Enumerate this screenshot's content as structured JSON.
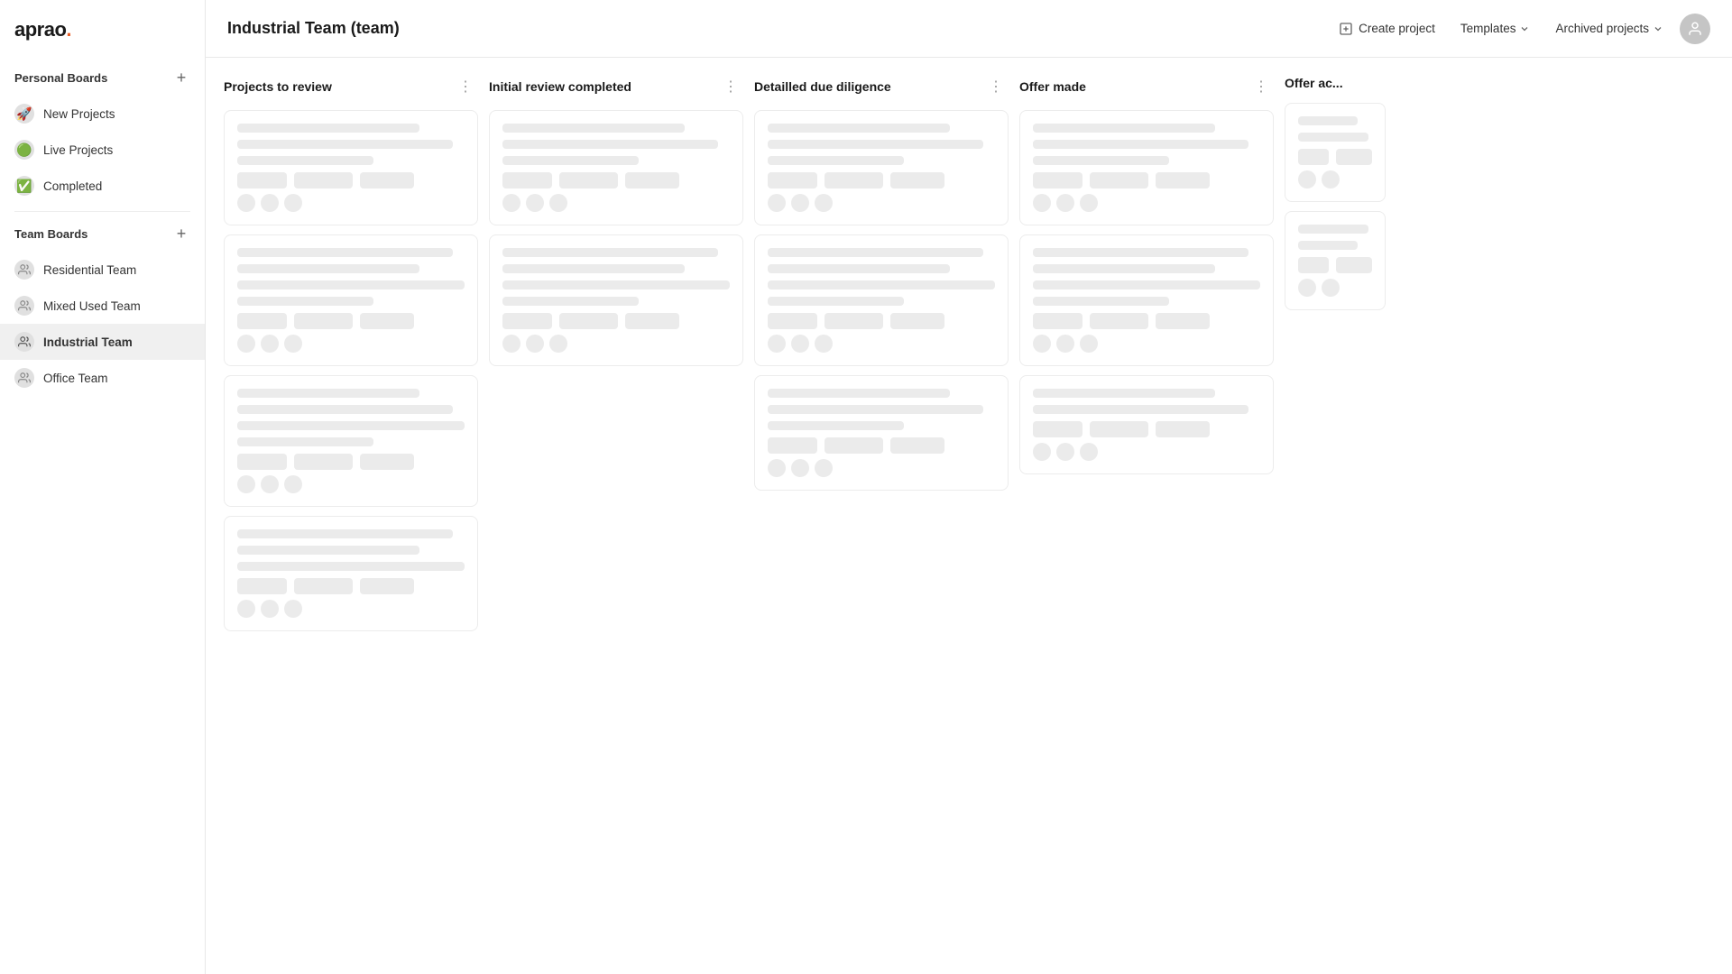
{
  "app": {
    "logo": "aprao",
    "logo_accent": "."
  },
  "sidebar": {
    "personal_boards_label": "Personal Boards",
    "team_boards_label": "Team Boards",
    "personal_items": [
      {
        "id": "new-projects",
        "label": "New Projects",
        "emoji": "🚀"
      },
      {
        "id": "live-projects",
        "label": "Live Projects",
        "emoji": "🟢"
      },
      {
        "id": "completed",
        "label": "Completed",
        "emoji": "✅"
      }
    ],
    "team_items": [
      {
        "id": "residential-team",
        "label": "Residential Team"
      },
      {
        "id": "mixed-used-team",
        "label": "Mixed Used Team"
      },
      {
        "id": "industrial-team",
        "label": "Industrial Team",
        "active": true
      },
      {
        "id": "office-team",
        "label": "Office Team"
      }
    ]
  },
  "topbar": {
    "page_title": "Industrial Team (team)",
    "create_project_label": "Create project",
    "templates_label": "Templates",
    "archived_label": "Archived projects"
  },
  "board": {
    "columns": [
      {
        "id": "projects-to-review",
        "title": "Projects to review"
      },
      {
        "id": "initial-review-completed",
        "title": "Initial review completed"
      },
      {
        "id": "detailed-due-diligence",
        "title": "Detailled due diligence"
      },
      {
        "id": "offer-made",
        "title": "Offer made"
      },
      {
        "id": "offer-accepted",
        "title": "Offer ac..."
      }
    ]
  }
}
